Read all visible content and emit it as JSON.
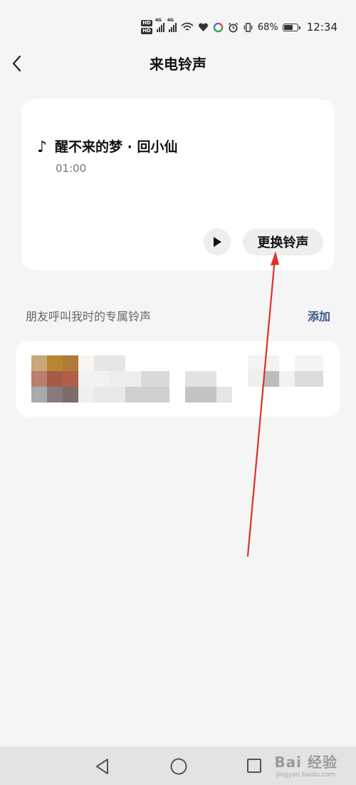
{
  "status_bar": {
    "time": "12:34",
    "battery_percent": "68%",
    "battery_level": 0.68,
    "icons": [
      "hd-icon",
      "signal-icon",
      "signal-icon",
      "wifi-icon",
      "heart-icon",
      "app-icon",
      "alarm-icon",
      "vibrate-icon",
      "battery-icon"
    ]
  },
  "header": {
    "title": "来电铃声",
    "back_icon": "chevron-left-icon"
  },
  "ringtone": {
    "note_symbol": "♪",
    "title": "醒不来的梦 · 回小仙",
    "duration": "01:00",
    "play_icon": "play-icon",
    "change_label": "更换铃声"
  },
  "contacts_section": {
    "label": "朋友呼叫我时的专属铃声",
    "add_label": "添加"
  },
  "annotation": {
    "color": "#e0312a"
  },
  "nav": {
    "icons": [
      "nav-back-icon",
      "nav-home-icon",
      "nav-recent-icon"
    ]
  },
  "watermark": {
    "main": "Bai 经验",
    "sub": "jingyan.baidu.com"
  }
}
